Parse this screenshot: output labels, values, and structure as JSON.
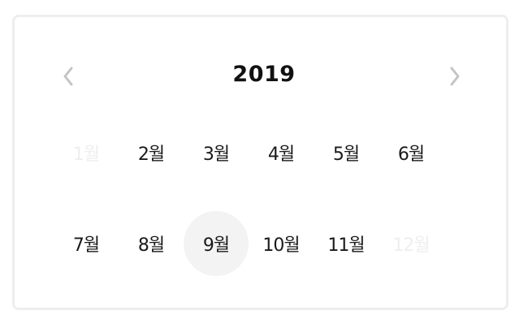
{
  "calendar": {
    "year": "2019",
    "prev_icon": "chevron-left-icon",
    "next_icon": "chevron-right-icon",
    "months": [
      {
        "label": "1월",
        "state": "disabled"
      },
      {
        "label": "2월",
        "state": "normal"
      },
      {
        "label": "3월",
        "state": "normal"
      },
      {
        "label": "4월",
        "state": "normal"
      },
      {
        "label": "5월",
        "state": "normal"
      },
      {
        "label": "6월",
        "state": "normal"
      },
      {
        "label": "7월",
        "state": "normal"
      },
      {
        "label": "8월",
        "state": "normal"
      },
      {
        "label": "9월",
        "state": "selected"
      },
      {
        "label": "10월",
        "state": "normal"
      },
      {
        "label": "11월",
        "state": "normal"
      },
      {
        "label": "12월",
        "state": "disabled"
      }
    ]
  },
  "colors": {
    "text": "#1a1a1a",
    "disabled_text": "#eeeeee",
    "selected_bg": "#f3f3f3",
    "border": "#eeeeee",
    "chevron": "#c4c4c4"
  }
}
